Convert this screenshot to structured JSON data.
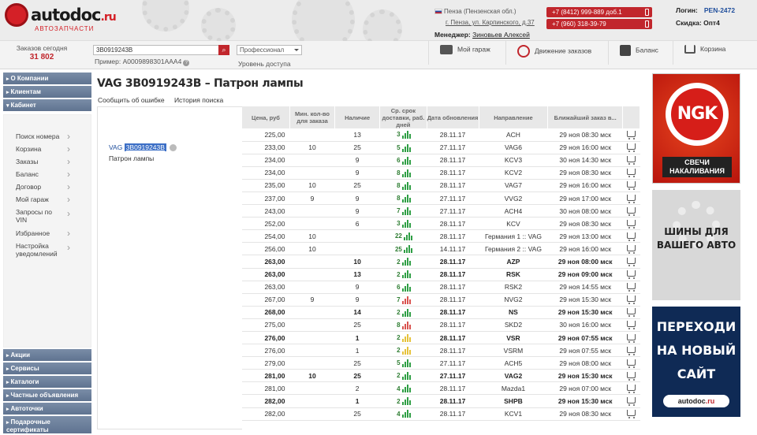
{
  "header": {
    "brand": "autodoc",
    "brand_suffix": ".ru",
    "tagline": "АВТОЗАПЧАСТИ",
    "location": "Пенза (Пензенская обл.)",
    "address": "г. Пенза, ул. Карпинского, д.37",
    "manager_label": "Менеджер:",
    "manager_name": "Зиновьев Алексей",
    "phone1": "+7 (8412) 999-889 доб.1",
    "phone2": "+7 (960) 318-39-79",
    "login_label": "Логин:",
    "login_value": "PEN-2472",
    "discount": "Скидка: Опт4"
  },
  "toolbar": {
    "orders_today_label": "Заказов сегодня",
    "orders_today_value": "31 802",
    "search_value": "3B0919243B",
    "example_label": "Пример:",
    "example_value": "A0009898301AAA4",
    "level_value": "Профессионал",
    "level_label": "Уровень доступа",
    "garage": "Мой гараж",
    "movement": "Движение заказов",
    "balance": "Баланс",
    "cart": "Корзина"
  },
  "sidebar": {
    "sections": [
      "О Компании",
      "Клиентам",
      "Кабинет"
    ],
    "items": [
      "Поиск номера",
      "Корзина",
      "Заказы",
      "Баланс",
      "Договор",
      "Мой гараж",
      "Запросы по VIN",
      "Избранное",
      "Настройка уведомлений"
    ],
    "bottom": [
      "Акции",
      "Сервисы",
      "Каталоги",
      "Частные объявления",
      "Автоточки",
      "Подарочные сертификаты"
    ]
  },
  "page": {
    "title": "VAG 3B0919243B – Патрон лампы",
    "link_report": "Сообщить об ошибке",
    "link_history": "История поиска",
    "part_brand": "VAG",
    "part_number": "3B0919243B",
    "part_name": "Патрон лампы"
  },
  "table": {
    "headers": [
      "Цена, руб",
      "Мин. кол-во для заказа",
      "Наличие",
      "Ср. срок доставки, раб. дней",
      "Дата обновления",
      "Направление",
      "Ближайший заказ в..."
    ],
    "rows": [
      {
        "price": "225,00",
        "min": "",
        "stock": "13",
        "days": "3",
        "bar": "g",
        "date": "28.11.17",
        "dir": "ACH",
        "next": "29 ноя 08:30 мск",
        "bold": false
      },
      {
        "price": "233,00",
        "min": "10",
        "stock": "25",
        "days": "5",
        "bar": "g",
        "date": "27.11.17",
        "dir": "VAG6",
        "next": "29 ноя 16:00 мск",
        "bold": false
      },
      {
        "price": "234,00",
        "min": "",
        "stock": "9",
        "days": "6",
        "bar": "g",
        "date": "28.11.17",
        "dir": "KCV3",
        "next": "30 ноя 14:30 мск",
        "bold": false
      },
      {
        "price": "234,00",
        "min": "",
        "stock": "9",
        "days": "8",
        "bar": "g",
        "date": "28.11.17",
        "dir": "KCV2",
        "next": "29 ноя 08:30 мск",
        "bold": false
      },
      {
        "price": "235,00",
        "min": "10",
        "stock": "25",
        "days": "8",
        "bar": "g",
        "date": "28.11.17",
        "dir": "VAG7",
        "next": "29 ноя 16:00 мск",
        "bold": false
      },
      {
        "price": "237,00",
        "min": "9",
        "stock": "9",
        "days": "8",
        "bar": "g",
        "date": "27.11.17",
        "dir": "VVG2",
        "next": "29 ноя 17:00 мск",
        "bold": false
      },
      {
        "price": "243,00",
        "min": "",
        "stock": "9",
        "days": "7",
        "bar": "g",
        "date": "27.11.17",
        "dir": "ACH4",
        "next": "30 ноя 08:00 мск",
        "bold": false
      },
      {
        "price": "252,00",
        "min": "",
        "stock": "6",
        "days": "3",
        "bar": "g",
        "date": "28.11.17",
        "dir": "KCV",
        "next": "29 ноя 08:30 мск",
        "bold": false
      },
      {
        "price": "254,00",
        "min": "10",
        "stock": "",
        "days": "22",
        "bar": "g",
        "date": "28.11.17",
        "dir": "Германия 1 :: VAG",
        "next": "29 ноя 13:00 мск",
        "bold": false
      },
      {
        "price": "256,00",
        "min": "10",
        "stock": "",
        "days": "25",
        "bar": "g",
        "date": "14.11.17",
        "dir": "Германия 2 :: VAG",
        "next": "29 ноя 16:00 мск",
        "bold": false
      },
      {
        "price": "263,00",
        "min": "",
        "stock": "10",
        "days": "2",
        "bar": "g",
        "date": "28.11.17",
        "dir": "AZP",
        "next": "29 ноя 08:00 мск",
        "bold": true
      },
      {
        "price": "263,00",
        "min": "",
        "stock": "13",
        "days": "2",
        "bar": "g",
        "date": "28.11.17",
        "dir": "RSK",
        "next": "29 ноя 09:00 мск",
        "bold": true
      },
      {
        "price": "263,00",
        "min": "",
        "stock": "9",
        "days": "6",
        "bar": "g",
        "date": "28.11.17",
        "dir": "RSK2",
        "next": "29 ноя 14:55 мск",
        "bold": false
      },
      {
        "price": "267,00",
        "min": "9",
        "stock": "9",
        "days": "7",
        "bar": "r",
        "date": "28.11.17",
        "dir": "NVG2",
        "next": "29 ноя 15:30 мск",
        "bold": false
      },
      {
        "price": "268,00",
        "min": "",
        "stock": "14",
        "days": "2",
        "bar": "g",
        "date": "28.11.17",
        "dir": "NS",
        "next": "29 ноя 15:30 мск",
        "bold": true
      },
      {
        "price": "275,00",
        "min": "",
        "stock": "25",
        "days": "8",
        "bar": "r",
        "date": "28.11.17",
        "dir": "SKD2",
        "next": "30 ноя 16:00 мск",
        "bold": false
      },
      {
        "price": "276,00",
        "min": "",
        "stock": "1",
        "days": "2",
        "bar": "y",
        "date": "28.11.17",
        "dir": "VSR",
        "next": "29 ноя 07:55 мск",
        "bold": true
      },
      {
        "price": "276,00",
        "min": "",
        "stock": "1",
        "days": "2",
        "bar": "y",
        "date": "28.11.17",
        "dir": "VSRM",
        "next": "29 ноя 07:55 мск",
        "bold": false
      },
      {
        "price": "279,00",
        "min": "",
        "stock": "25",
        "days": "5",
        "bar": "g",
        "date": "27.11.17",
        "dir": "ACH5",
        "next": "29 ноя 08:00 мск",
        "bold": false
      },
      {
        "price": "281,00",
        "min": "10",
        "stock": "25",
        "days": "2",
        "bar": "g",
        "date": "27.11.17",
        "dir": "VAG2",
        "next": "29 ноя 15:30 мск",
        "bold": true
      },
      {
        "price": "281,00",
        "min": "",
        "stock": "2",
        "days": "4",
        "bar": "g",
        "date": "28.11.17",
        "dir": "Mazda1",
        "next": "29 ноя 07:00 мск",
        "bold": false
      },
      {
        "price": "282,00",
        "min": "",
        "stock": "1",
        "days": "2",
        "bar": "g",
        "date": "28.11.17",
        "dir": "SHPB",
        "next": "29 ноя 15:30 мск",
        "bold": true
      },
      {
        "price": "282,00",
        "min": "",
        "stock": "25",
        "days": "4",
        "bar": "g",
        "date": "28.11.17",
        "dir": "KCV1",
        "next": "29 ноя 08:30 мск",
        "bold": false
      }
    ]
  },
  "ads": {
    "ngk_logo": "NGK",
    "ngk_caption": "СВЕЧИ НАКАЛИВАНИЯ",
    "tires": "ШИНЫ ДЛЯ ВАШЕГО АВТО",
    "newsite": "ПЕРЕХОДИ НА НОВЫЙ САЙТ",
    "newsite_brand": "autodoc",
    "newsite_suffix": ".ru"
  },
  "colors": {
    "accent": "#c1262c",
    "bar_green": "#2e9e44",
    "bar_red": "#d9534f",
    "bar_yellow": "#e6c23a"
  }
}
